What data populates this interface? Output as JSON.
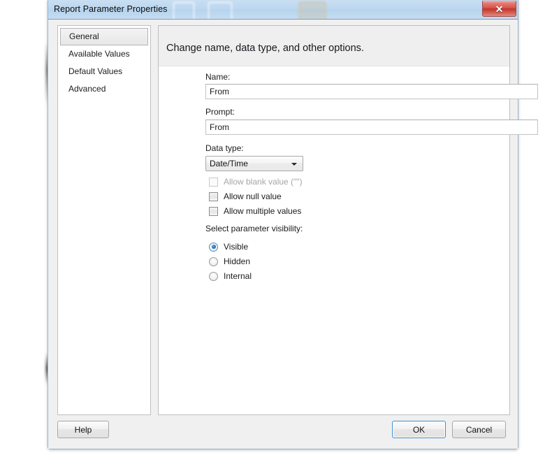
{
  "window": {
    "title": "Report Parameter Properties",
    "close_icon": "close-icon",
    "close_glyph": "✕"
  },
  "nav": {
    "items": [
      {
        "label": "General",
        "selected": true
      },
      {
        "label": "Available Values",
        "selected": false
      },
      {
        "label": "Default Values",
        "selected": false
      },
      {
        "label": "Advanced",
        "selected": false
      }
    ]
  },
  "content": {
    "header": "Change name, data type, and other options.",
    "fields": {
      "name": {
        "label": "Name:",
        "value": "From",
        "placeholder": ""
      },
      "prompt": {
        "label": "Prompt:",
        "value": "From",
        "placeholder": ""
      },
      "data_type": {
        "label": "Data type:",
        "value": "Date/Time",
        "arrow_icon": "chevron-down-icon"
      }
    },
    "checkboxes": [
      {
        "label": "Allow blank value (\"\")",
        "checked": false,
        "disabled": true
      },
      {
        "label": "Allow null value",
        "checked": false,
        "disabled": false
      },
      {
        "label": "Allow multiple values",
        "checked": false,
        "disabled": false
      }
    ],
    "visibility": {
      "label": "Select parameter visibility:",
      "options": [
        {
          "label": "Visible",
          "checked": true
        },
        {
          "label": "Hidden",
          "checked": false
        },
        {
          "label": "Internal",
          "checked": false
        }
      ]
    }
  },
  "footer": {
    "help_label": "Help",
    "ok_label": "OK",
    "cancel_label": "Cancel"
  },
  "colors": {
    "title_bar": "#bcd7ef",
    "dialog_face": "#f0f0f0",
    "close_button": "#c0342b",
    "accent_focus": "#3c8ed0",
    "radio_dot": "#1c6fc0",
    "header_band": "#efefef"
  }
}
